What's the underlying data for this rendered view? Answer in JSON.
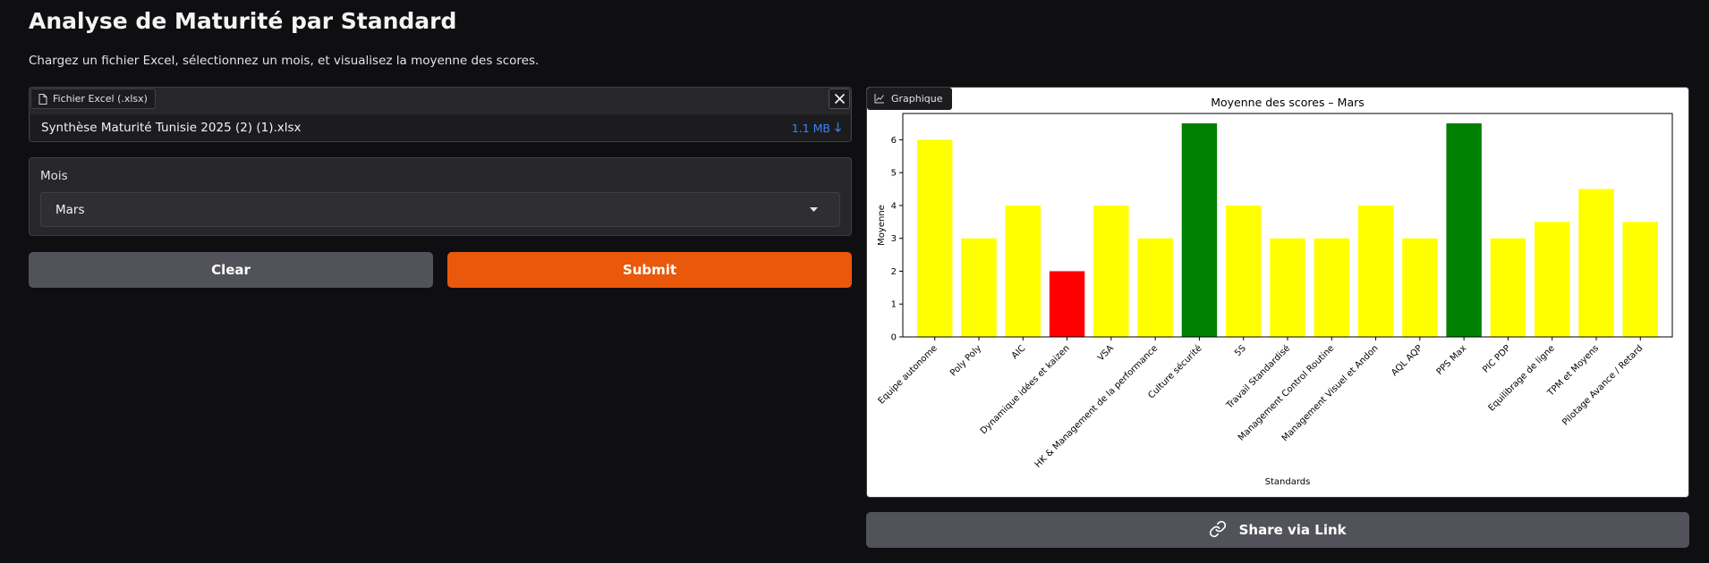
{
  "header": {
    "title": "Analyse de Maturité par Standard",
    "subtitle": "Chargez un fichier Excel, sélectionnez un mois, et visualisez la moyenne des scores."
  },
  "file_upload": {
    "label": "Fichier Excel (.xlsx)",
    "file_name": "Synthèse Maturité Tunisie 2025 (2) (1).xlsx",
    "file_size": "1.1 MB"
  },
  "month_select": {
    "label": "Mois",
    "value": "Mars"
  },
  "buttons": {
    "clear": "Clear",
    "submit": "Submit",
    "share": "Share via Link"
  },
  "chart_panel": {
    "label": "Graphique"
  },
  "colors": {
    "yellow": "#ffff00",
    "green": "#008000",
    "red": "#ff0000",
    "submit": "#ea580c"
  },
  "chart_data": {
    "type": "bar",
    "title": "Moyenne des scores – Mars",
    "xlabel": "Standards",
    "ylabel": "Moyenne",
    "ylim": [
      0,
      6.8
    ],
    "yticks": [
      0,
      1,
      2,
      3,
      4,
      5,
      6
    ],
    "grid": false,
    "categories": [
      "Equipe autonome",
      "Poly Poly",
      "AIC",
      "Dynamique idées et kaizen",
      "VSA",
      "HK & Management de la performance",
      "Culture sécurité",
      "5S",
      "Travail Standardisé",
      "Management Control Routine",
      "Management Visuel et Andon",
      "AQL AQP",
      "PPS Max",
      "PIC PDP",
      "Equilibrage de ligne",
      "TPM et Moyens",
      "Pilotage Avance / Retard"
    ],
    "values": [
      6,
      3,
      4,
      2,
      4,
      3,
      6.5,
      4,
      3,
      3,
      4,
      3,
      6.5,
      3,
      3.5,
      4.5,
      3.5
    ],
    "bar_colors": [
      "yellow",
      "yellow",
      "yellow",
      "red",
      "yellow",
      "yellow",
      "green",
      "yellow",
      "yellow",
      "yellow",
      "yellow",
      "yellow",
      "green",
      "yellow",
      "yellow",
      "yellow",
      "yellow"
    ]
  }
}
